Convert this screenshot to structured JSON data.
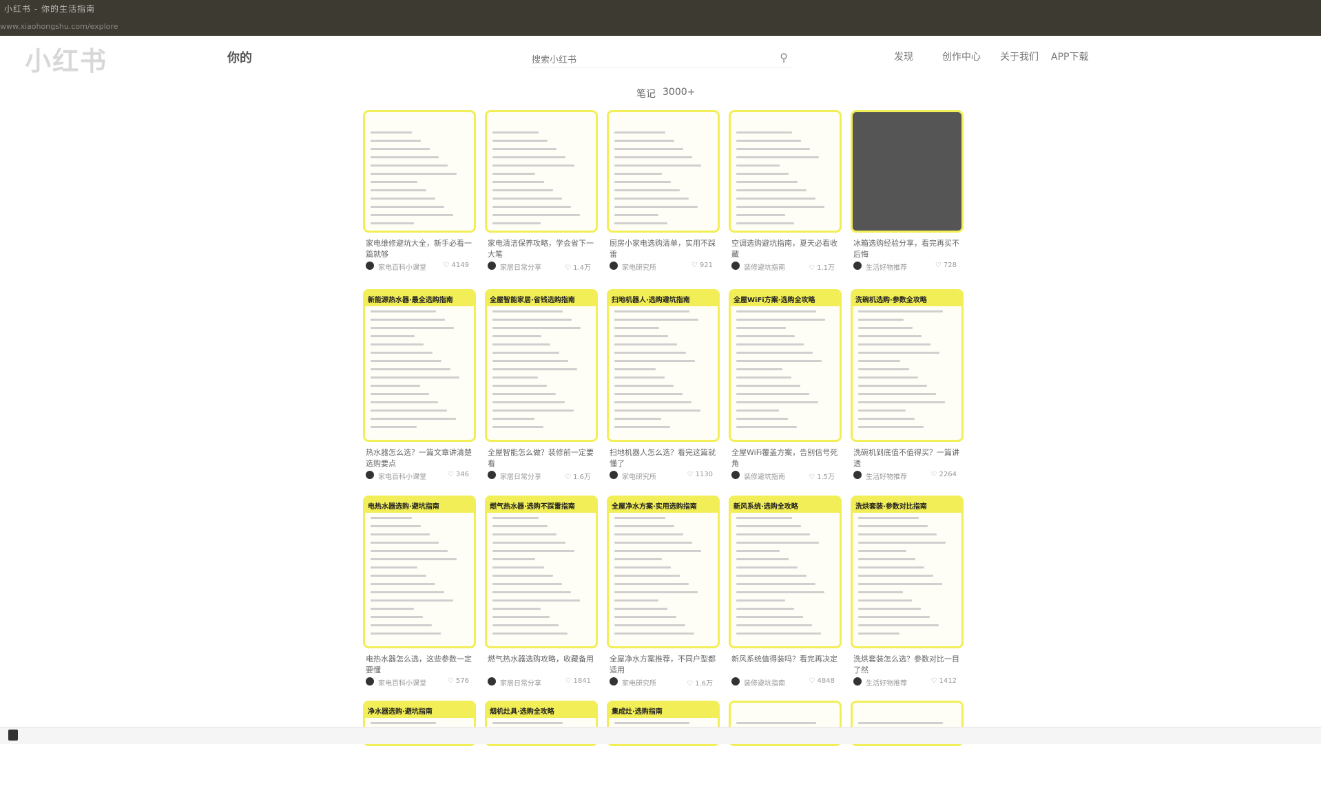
{
  "browser": {
    "tab_text": "小红书 - 你的生活指南",
    "address_text": "www.xiaohongshu.com/explore"
  },
  "header": {
    "logo": "小红书",
    "logo_sub": "你的",
    "search_placeholder": "搜索小红书",
    "nav": [
      "发现",
      "创作中心",
      "关于我们",
      "APP下载"
    ]
  },
  "channel": {
    "label": "笔记",
    "count": "3000+"
  },
  "cards": [
    {
      "band": "",
      "title": "家电维修避坑大全，新手必看一篇就够",
      "author": "家电百科小课堂",
      "likes": "4149"
    },
    {
      "band": "",
      "title": "家电清洁保养攻略，学会省下一大笔",
      "author": "家居日常分享",
      "likes": "1.4万"
    },
    {
      "band": "",
      "title": "厨房小家电选购清单，实用不踩雷",
      "author": "家电研究所",
      "likes": "921"
    },
    {
      "band": "",
      "title": "空调选购避坑指南，夏天必看收藏",
      "author": "装修避坑指南",
      "likes": "1.1万"
    },
    {
      "band": "",
      "title": "冰箱选购经验分享，看完再买不后悔",
      "author": "生活好物推荐",
      "likes": "728"
    },
    {
      "band": "新能源热水器·最全选购指南",
      "title": "热水器怎么选？一篇文章讲清楚选购要点",
      "author": "家电百科小课堂",
      "likes": "346"
    },
    {
      "band": "全屋智能家居·省钱选购指南",
      "title": "全屋智能怎么做？装修前一定要看",
      "author": "家居日常分享",
      "likes": "1.6万"
    },
    {
      "band": "扫地机器人·选购避坑指南",
      "title": "扫地机器人怎么选？看完这篇就懂了",
      "author": "家电研究所",
      "likes": "1130"
    },
    {
      "band": "全屋WiFi方案·选购全攻略",
      "title": "全屋WiFi覆盖方案，告别信号死角",
      "author": "装修避坑指南",
      "likes": "1.5万"
    },
    {
      "band": "洗碗机选购·参数全攻略",
      "title": "洗碗机到底值不值得买？一篇讲透",
      "author": "生活好物推荐",
      "likes": "2264"
    },
    {
      "band": "电热水器选购·避坑指南",
      "title": "电热水器怎么选，这些参数一定要懂",
      "author": "家电百科小课堂",
      "likes": "576"
    },
    {
      "band": "燃气热水器·选购不踩雷指南",
      "title": "燃气热水器选购攻略，收藏备用",
      "author": "家居日常分享",
      "likes": "1841"
    },
    {
      "band": "全屋净水方案·实用选购指南",
      "title": "全屋净水方案推荐，不同户型都适用",
      "author": "家电研究所",
      "likes": "1.6万"
    },
    {
      "band": "新风系统·选购全攻略",
      "title": "新风系统值得装吗？看完再决定",
      "author": "装修避坑指南",
      "likes": "4848"
    },
    {
      "band": "洗烘套装·参数对比指南",
      "title": "洗烘套装怎么选？参数对比一目了然",
      "author": "生活好物推荐",
      "likes": "1412"
    },
    {
      "band": "净水器选购·避坑指南",
      "title": "",
      "author": "",
      "likes": ""
    },
    {
      "band": "烟机灶具·选购全攻略",
      "title": "",
      "author": "",
      "likes": ""
    },
    {
      "band": "集成灶·选购指南",
      "title": "",
      "author": "",
      "likes": ""
    },
    {
      "band": "",
      "title": "",
      "author": "",
      "likes": ""
    },
    {
      "band": "",
      "title": "",
      "author": "",
      "likes": ""
    }
  ]
}
